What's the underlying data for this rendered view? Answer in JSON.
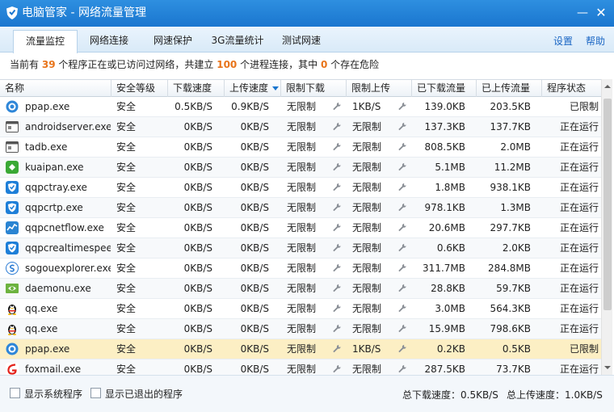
{
  "window": {
    "title": "电脑管家 - 网络流量管理",
    "min_label": "—",
    "close_label": "✕"
  },
  "tabs": [
    {
      "label": "流量监控",
      "active": true
    },
    {
      "label": "网络连接",
      "active": false
    },
    {
      "label": "网速保护",
      "active": false
    },
    {
      "label": "3G流量统计",
      "active": false
    },
    {
      "label": "测试网速",
      "active": false
    }
  ],
  "links": {
    "settings": "设置",
    "help": "帮助"
  },
  "summary": {
    "part1": "当前有",
    "programs": "39",
    "part2": "个程序正在或已访问过网络，共建立",
    "connections": "100",
    "part3": "个进程连接，其中",
    "danger": "0",
    "part4": "个存在危险"
  },
  "columns": [
    "名称",
    "安全等级",
    "下载速度",
    "上传速度",
    "限制下载",
    "限制上传",
    "已下载流量",
    "已上传流量",
    "程序状态"
  ],
  "rows": [
    {
      "name": "ppap.exe",
      "icon": "ppap-icon",
      "safety": "安全",
      "down": "0.5KB/S",
      "up": "0.9KB/S",
      "limit_down": "无限制",
      "limit_up": "1KB/S",
      "downloaded": "139.0KB",
      "uploaded": "203.5KB",
      "status": "已限制"
    },
    {
      "name": "androidserver.exe",
      "icon": "window-app-icon",
      "safety": "安全",
      "down": "0KB/S",
      "up": "0KB/S",
      "limit_down": "无限制",
      "limit_up": "无限制",
      "downloaded": "137.3KB",
      "uploaded": "137.7KB",
      "status": "正在运行"
    },
    {
      "name": "tadb.exe",
      "icon": "window-app-icon",
      "safety": "安全",
      "down": "0KB/S",
      "up": "0KB/S",
      "limit_down": "无限制",
      "limit_up": "无限制",
      "downloaded": "808.5KB",
      "uploaded": "2.0MB",
      "status": "正在运行"
    },
    {
      "name": "kuaipan.exe",
      "icon": "kuaipan-icon",
      "safety": "安全",
      "down": "0KB/S",
      "up": "0KB/S",
      "limit_down": "无限制",
      "limit_up": "无限制",
      "downloaded": "5.1MB",
      "uploaded": "11.2MB",
      "status": "正在运行"
    },
    {
      "name": "qqpctray.exe",
      "icon": "qqpc-shield-icon",
      "safety": "安全",
      "down": "0KB/S",
      "up": "0KB/S",
      "limit_down": "无限制",
      "limit_up": "无限制",
      "downloaded": "1.8MB",
      "uploaded": "938.1KB",
      "status": "正在运行"
    },
    {
      "name": "qqpcrtp.exe",
      "icon": "qqpc-shield-icon",
      "safety": "安全",
      "down": "0KB/S",
      "up": "0KB/S",
      "limit_down": "无限制",
      "limit_up": "无限制",
      "downloaded": "978.1KB",
      "uploaded": "1.3MB",
      "status": "正在运行"
    },
    {
      "name": "qqpcnetflow.exe",
      "icon": "netflow-icon",
      "safety": "安全",
      "down": "0KB/S",
      "up": "0KB/S",
      "limit_down": "无限制",
      "limit_up": "无限制",
      "downloaded": "20.6MB",
      "uploaded": "297.7KB",
      "status": "正在运行"
    },
    {
      "name": "qqpcrealtimespeed...",
      "icon": "qqpc-shield-icon",
      "safety": "安全",
      "down": "0KB/S",
      "up": "0KB/S",
      "limit_down": "无限制",
      "limit_up": "无限制",
      "downloaded": "0.6KB",
      "uploaded": "2.0KB",
      "status": "正在运行"
    },
    {
      "name": "sogouexplorer.exe",
      "icon": "sogou-icon",
      "safety": "安全",
      "down": "0KB/S",
      "up": "0KB/S",
      "limit_down": "无限制",
      "limit_up": "无限制",
      "downloaded": "311.7MB",
      "uploaded": "284.8MB",
      "status": "正在运行"
    },
    {
      "name": "daemonu.exe",
      "icon": "nvidia-icon",
      "safety": "安全",
      "down": "0KB/S",
      "up": "0KB/S",
      "limit_down": "无限制",
      "limit_up": "无限制",
      "downloaded": "28.8KB",
      "uploaded": "59.7KB",
      "status": "正在运行"
    },
    {
      "name": "qq.exe",
      "icon": "qq-penguin-icon",
      "safety": "安全",
      "down": "0KB/S",
      "up": "0KB/S",
      "limit_down": "无限制",
      "limit_up": "无限制",
      "downloaded": "3.0MB",
      "uploaded": "564.3KB",
      "status": "正在运行"
    },
    {
      "name": "qq.exe",
      "icon": "qq-penguin-icon",
      "safety": "安全",
      "down": "0KB/S",
      "up": "0KB/S",
      "limit_down": "无限制",
      "limit_up": "无限制",
      "downloaded": "15.9MB",
      "uploaded": "798.6KB",
      "status": "正在运行"
    },
    {
      "name": "ppap.exe",
      "icon": "ppap-icon",
      "safety": "安全",
      "down": "0KB/S",
      "up": "0KB/S",
      "limit_down": "无限制",
      "limit_up": "1KB/S",
      "downloaded": "0.2KB",
      "uploaded": "0.5KB",
      "status": "已限制",
      "selected": true
    },
    {
      "name": "foxmail.exe",
      "icon": "foxmail-icon",
      "safety": "安全",
      "down": "0KB/S",
      "up": "0KB/S",
      "limit_down": "无限制",
      "limit_up": "无限制",
      "downloaded": "287.5KB",
      "uploaded": "73.7KB",
      "status": "正在运行"
    }
  ],
  "footer": {
    "show_system": "显示系统程序",
    "show_exited": "显示已退出的程序",
    "total_down": "总下载速度：0.5KB/S",
    "total_up": "总上传速度：1.0KB/S"
  },
  "colors": {
    "titlebar": "#1a76cf",
    "accent_number": "#e8741a",
    "link": "#1a66c4",
    "selected_row": "#fcefc4"
  }
}
